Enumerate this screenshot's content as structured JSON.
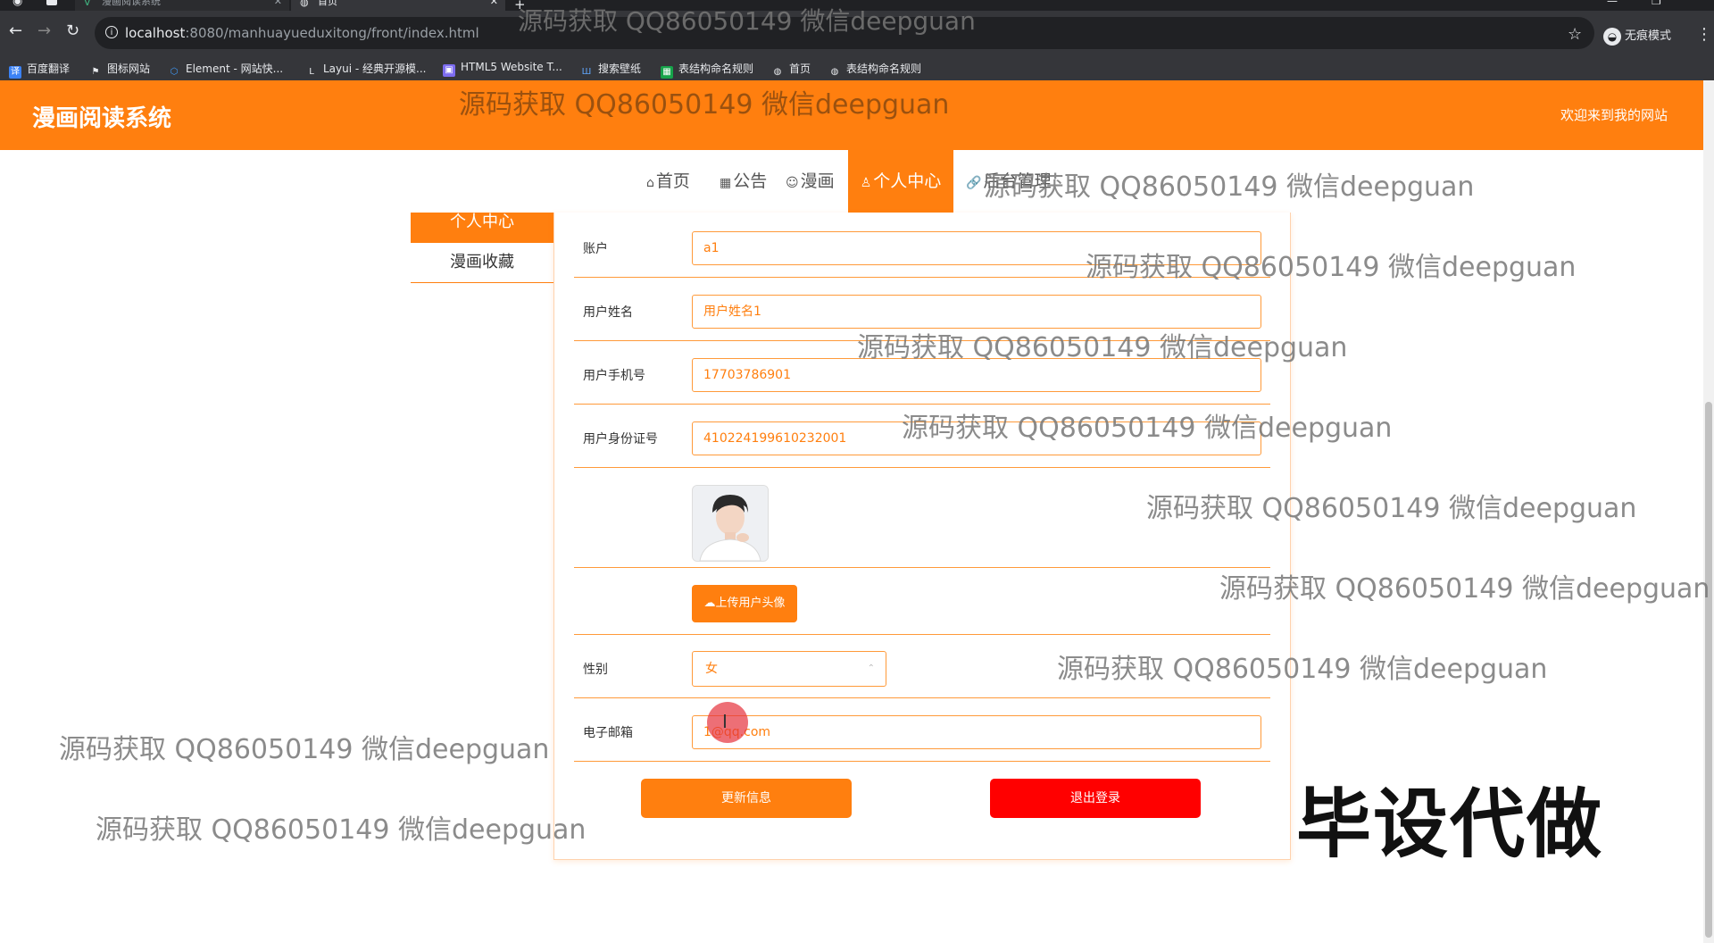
{
  "browser": {
    "tabs": [
      {
        "title": "漫画阅读系统",
        "active": false
      },
      {
        "title": "首页",
        "active": true
      }
    ],
    "url_host": "localhost",
    "url_rest": ":8080/manhuayueduxitong/front/index.html",
    "profile_label": "无痕模式",
    "bookmarks": [
      "百度翻译",
      "图标网站",
      "Element - 网站快...",
      "Layui - 经典开源模...",
      "HTML5 Website T...",
      "搜索壁纸",
      "表结构命名规则",
      "首页",
      "表结构命名规则"
    ]
  },
  "header": {
    "brand": "漫画阅读系统",
    "welcome": "欢迎来到我的网站"
  },
  "nav": {
    "home": "首页",
    "notice": "公告",
    "comic": "漫画",
    "profile": "个人中心",
    "admin": "后台管理"
  },
  "side_menu": {
    "profile": "个人中心",
    "favorites": "漫画收藏"
  },
  "form": {
    "account_label": "账户",
    "account_value": "a1",
    "name_label": "用户姓名",
    "name_value": "用户姓名1",
    "phone_label": "用户手机号",
    "phone_value": "17703786901",
    "idcard_label": "用户身份证号",
    "idcard_value": "410224199610232001",
    "upload_label": "上传用户头像",
    "gender_label": "性别",
    "gender_value": "女",
    "email_label": "电子邮箱",
    "email_value": "1@qq.com"
  },
  "buttons": {
    "update": "更新信息",
    "logout": "退出登录"
  },
  "overlays": {
    "watermark": "源码获取 QQ86050149 微信deepguan",
    "stamp": "毕设代做"
  },
  "colors": {
    "accent": "#ff7f0f",
    "danger": "#ff0000"
  }
}
